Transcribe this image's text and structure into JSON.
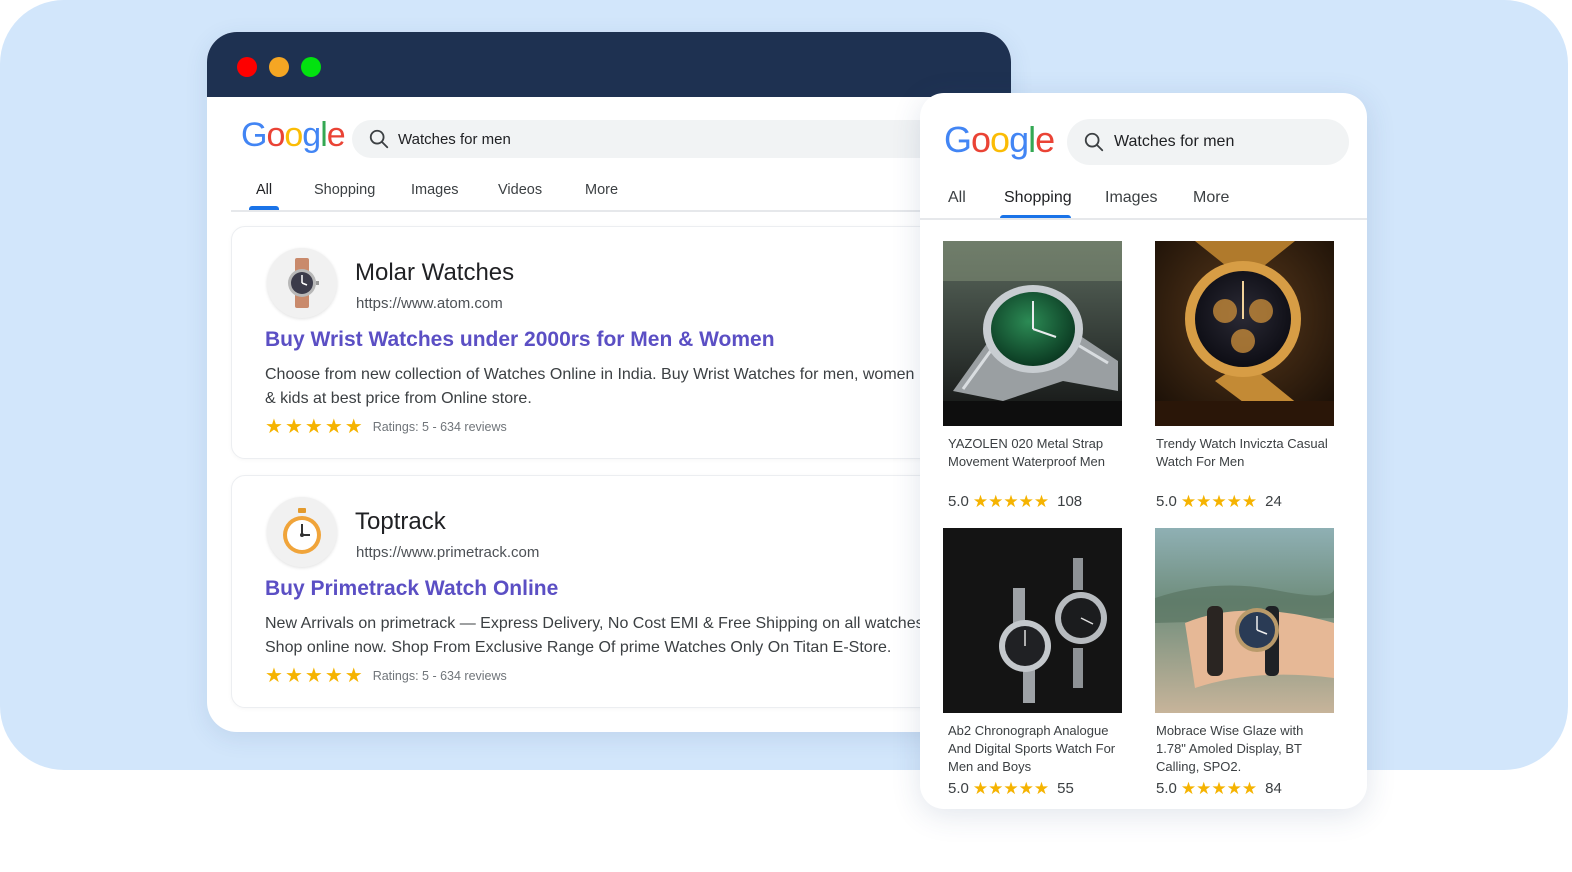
{
  "desktop": {
    "logo": [
      "G",
      "o",
      "o",
      "g",
      "l",
      "e"
    ],
    "search_query": "Watches for men",
    "tabs": [
      {
        "label": "All",
        "active": true
      },
      {
        "label": "Shopping",
        "active": false
      },
      {
        "label": "Images",
        "active": false
      },
      {
        "label": "Videos",
        "active": false
      },
      {
        "label": "More",
        "active": false
      }
    ],
    "results": [
      {
        "site_name": "Molar Watches",
        "url": "https://www.atom.com",
        "title": "Buy Wrist Watches under 2000rs for Men & Women",
        "snippet_line1": "Choose from new collection of Watches Online in India. Buy Wrist Watches for men, women",
        "snippet_line2": "& kids at best price from Online store.",
        "rating_stars": 5,
        "rating_text": "Ratings: 5 - 634 reviews",
        "icon": "wristwatch-icon"
      },
      {
        "site_name": "Toptrack",
        "url": "https://www.primetrack.com",
        "title": "Buy Primetrack Watch Online",
        "snippet_line1": "New Arrivals on primetrack — Express Delivery, No Cost EMI & Free Shipping on all watches.",
        "snippet_line2": "Shop online now. Shop From Exclusive Range Of prime Watches Only On Titan E-Store.",
        "rating_stars": 5,
        "rating_text": "Ratings: 5 - 634 reviews",
        "icon": "stopwatch-icon"
      }
    ]
  },
  "mobile": {
    "logo": [
      "G",
      "o",
      "o",
      "g",
      "l",
      "e"
    ],
    "search_query": "Watches for men",
    "tabs": [
      {
        "label": "All",
        "active": false
      },
      {
        "label": "Shopping",
        "active": true
      },
      {
        "label": "Images",
        "active": false
      },
      {
        "label": "More",
        "active": false
      }
    ],
    "products": [
      {
        "name": "YAZOLEN 020 Metal Strap Movement Waterproof Men",
        "score": "5.0",
        "count": "108",
        "image": "green-dial-watch-photo"
      },
      {
        "name": "Trendy Watch Inviczta Casual Watch For Men",
        "score": "5.0",
        "count": "24",
        "image": "gold-chronograph-watch-photo"
      },
      {
        "name": "Ab2 Chronograph Analogue And Digital Sports Watch For Men and Boys",
        "score": "5.0",
        "count": "55",
        "image": "two-steel-watches-photo"
      },
      {
        "name": "Mobrace Wise Glaze with 1.78\" Amoled Display, BT Calling, SPO2.",
        "score": "5.0",
        "count": "84",
        "image": "watch-on-wrist-photo"
      }
    ]
  },
  "colors": {
    "backdrop": "#d2e6fb",
    "titlebar": "#1e3151",
    "link_title": "#5b4fc4",
    "star": "#f5b301",
    "tab_underline": "#1a73e8"
  }
}
